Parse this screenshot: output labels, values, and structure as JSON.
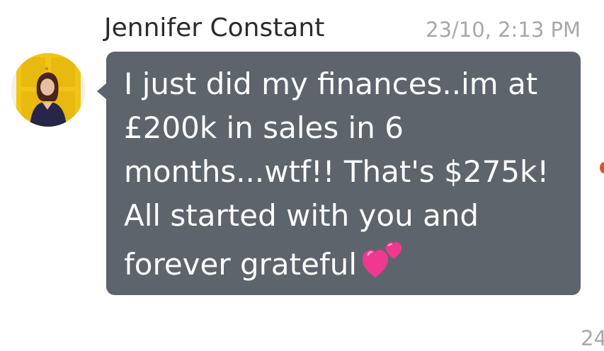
{
  "message": {
    "sender_name": "Jennifer Constant",
    "timestamp": "23/10, 2:13 PM",
    "lines": [
      "I just did my finances..im at",
      "£200k in sales in 6",
      "months...wtf!! That's $275k!",
      "All started with you and",
      "forever grateful"
    ],
    "emoji": "two-hearts-icon"
  },
  "next_message": {
    "timestamp_partial": "24"
  },
  "colors": {
    "bubble": "#5d646b",
    "bubble_text": "#ffffff",
    "sender_name": "#2b2b2b",
    "timestamp": "#a8a8a8",
    "avatar_bg": "#f1c518",
    "heart": "#f0388f"
  }
}
